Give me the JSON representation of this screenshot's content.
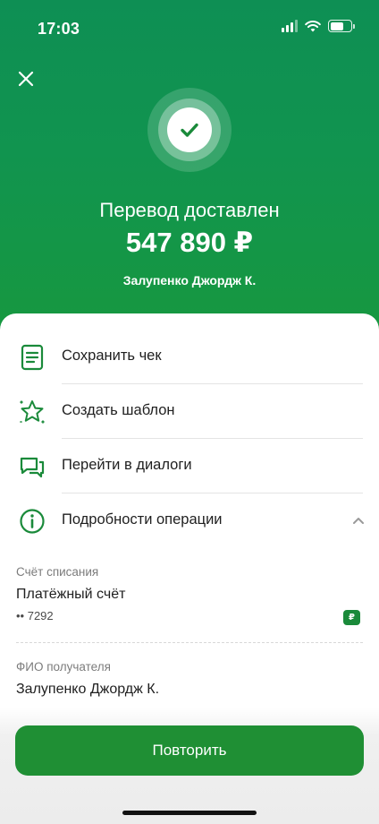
{
  "status_bar": {
    "time": "17:03"
  },
  "hero": {
    "title": "Перевод доставлен",
    "amount": "547 890 ₽",
    "recipient": "Залупенко Джордж К."
  },
  "actions": [
    {
      "label": "Сохранить чек",
      "icon": "receipt-icon"
    },
    {
      "label": "Создать шаблон",
      "icon": "star-icon"
    },
    {
      "label": "Перейти в диалоги",
      "icon": "chat-icon"
    },
    {
      "label": "Подробности операции",
      "icon": "info-icon"
    }
  ],
  "details": {
    "account_label": "Счёт списания",
    "account_value": "Платёжный счёт",
    "account_number": "•• 7292",
    "currency_badge": "₽",
    "recipient_label": "ФИО получателя",
    "recipient_value": "Залупенко Джордж К."
  },
  "buttons": {
    "repeat": "Повторить"
  },
  "colors": {
    "brand_green": "#1f8f34",
    "hero_top": "#0e8f54",
    "hero_bottom": "#17983f"
  }
}
